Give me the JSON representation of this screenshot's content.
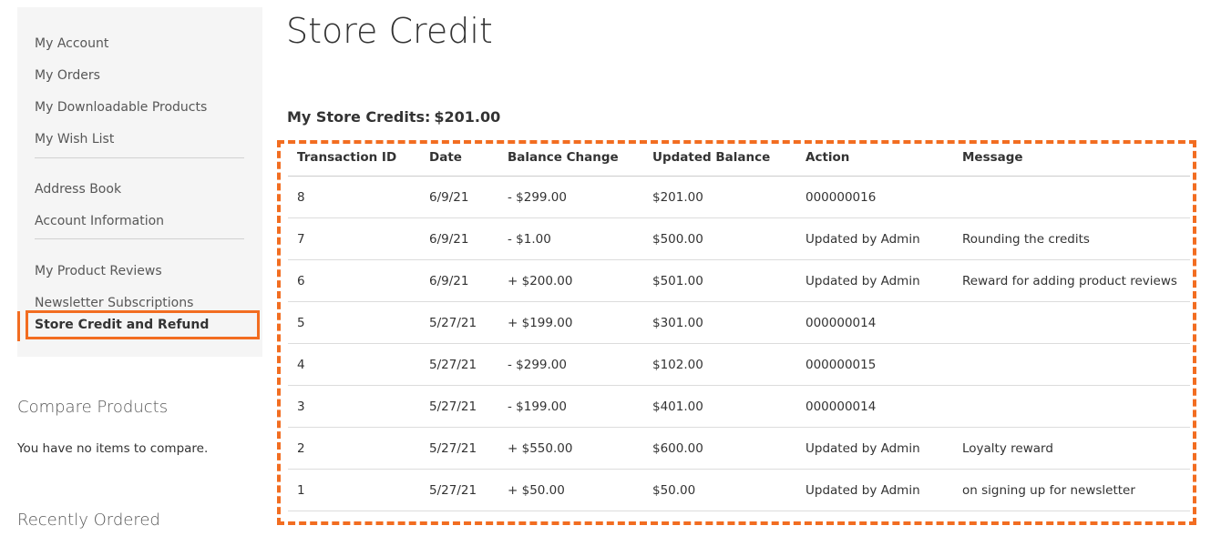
{
  "sidebar": {
    "group1": [
      "My Account",
      "My Orders",
      "My Downloadable Products",
      "My Wish List"
    ],
    "group2": [
      "Address Book",
      "Account Information"
    ],
    "group3": [
      "My Product Reviews",
      "Newsletter Subscriptions"
    ],
    "active": "Store Credit and Refund"
  },
  "compare": {
    "title": "Compare Products",
    "empty": "You have no items to compare."
  },
  "recent": {
    "title": "Recently Ordered"
  },
  "main": {
    "title": "Store Credit",
    "credits_label": "My Store Credits:",
    "credits_value": "$201.00"
  },
  "table": {
    "columns": [
      "Transaction ID",
      "Date",
      "Balance Change",
      "Updated Balance",
      "Action",
      "Message"
    ],
    "rows": [
      {
        "id": "8",
        "date": "6/9/21",
        "change": "- $299.00",
        "balance": "$201.00",
        "action": "000000016",
        "message": ""
      },
      {
        "id": "7",
        "date": "6/9/21",
        "change": "- $1.00",
        "balance": "$500.00",
        "action": "Updated by Admin",
        "message": "Rounding the credits"
      },
      {
        "id": "6",
        "date": "6/9/21",
        "change": "+ $200.00",
        "balance": "$501.00",
        "action": "Updated by Admin",
        "message": "Reward for adding product reviews"
      },
      {
        "id": "5",
        "date": "5/27/21",
        "change": "+ $199.00",
        "balance": "$301.00",
        "action": "000000014",
        "message": ""
      },
      {
        "id": "4",
        "date": "5/27/21",
        "change": "- $299.00",
        "balance": "$102.00",
        "action": "000000015",
        "message": ""
      },
      {
        "id": "3",
        "date": "5/27/21",
        "change": "- $199.00",
        "balance": "$401.00",
        "action": "000000014",
        "message": ""
      },
      {
        "id": "2",
        "date": "5/27/21",
        "change": "+ $550.00",
        "balance": "$600.00",
        "action": "Updated by Admin",
        "message": "Loyalty reward"
      },
      {
        "id": "1",
        "date": "5/27/21",
        "change": "+ $50.00",
        "balance": "$50.00",
        "action": "Updated by Admin",
        "message": "on signing up for newsletter"
      }
    ]
  },
  "colors": {
    "accent": "#f26d21",
    "negative": "#e02b27",
    "positive": "#006400"
  }
}
